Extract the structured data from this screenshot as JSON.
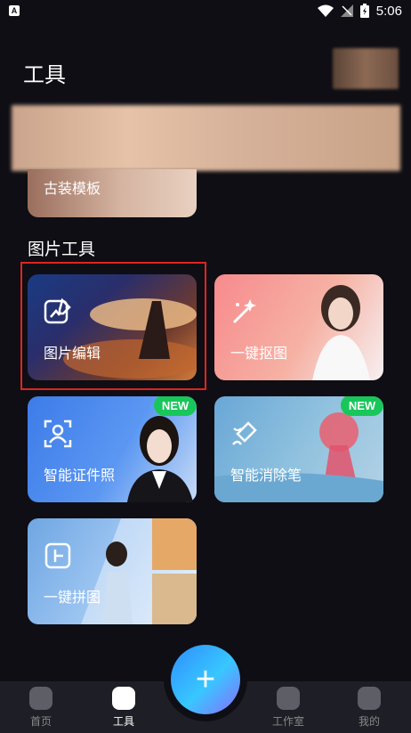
{
  "status": {
    "time": "5:06",
    "app_glyph": "A"
  },
  "header": {
    "title": "工具"
  },
  "partial_card": {
    "label": "古装模板"
  },
  "section": {
    "title": "图片工具"
  },
  "cards": [
    {
      "label": "图片编辑",
      "icon": "edit-image-icon",
      "badge": ""
    },
    {
      "label": "一键抠图",
      "icon": "magic-wand-icon",
      "badge": ""
    },
    {
      "label": "智能证件照",
      "icon": "id-photo-icon",
      "badge": "NEW"
    },
    {
      "label": "智能消除笔",
      "icon": "eraser-brush-icon",
      "badge": "NEW"
    },
    {
      "label": "一键拼图",
      "icon": "collage-icon",
      "badge": ""
    }
  ],
  "fab": {
    "label": "+"
  },
  "nav": [
    {
      "label": "首页",
      "icon": "home-icon"
    },
    {
      "label": "工具",
      "icon": "tools-icon"
    },
    {
      "label": "工作室",
      "icon": "studio-icon"
    },
    {
      "label": "我的",
      "icon": "profile-icon"
    }
  ],
  "colors": {
    "background": "#0e0e14",
    "badge": "#19c65a",
    "selection": "#e0241f",
    "bottom_bar": "#1e1e26"
  }
}
